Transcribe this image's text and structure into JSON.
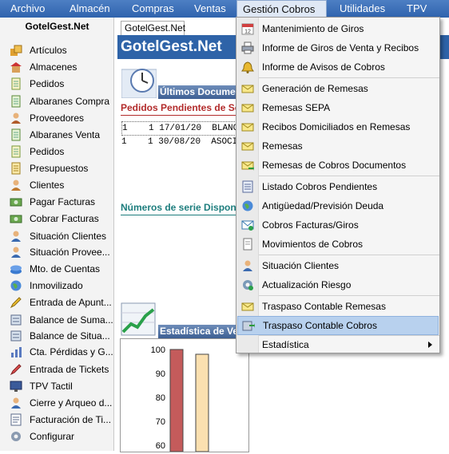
{
  "menubar": {
    "items": [
      "Archivo",
      "Almacén",
      "Compras",
      "Ventas",
      "Gestión Cobros",
      "Utilidades",
      "TPV"
    ]
  },
  "sidebar": {
    "title": "GotelGest.Net",
    "items": [
      {
        "label": "Artículos",
        "icon": "boxes-icon"
      },
      {
        "label": "Almacenes",
        "icon": "warehouse-icon"
      },
      {
        "label": "Pedidos",
        "icon": "document-icon"
      },
      {
        "label": "Albaranes Compra",
        "icon": "document-icon"
      },
      {
        "label": "Proveedores",
        "icon": "person-icon"
      },
      {
        "label": "Albaranes Venta",
        "icon": "document-icon"
      },
      {
        "label": "Pedidos",
        "icon": "document-icon"
      },
      {
        "label": "Presupuestos",
        "icon": "document-icon"
      },
      {
        "label": "Clientes",
        "icon": "person-icon"
      },
      {
        "label": "Pagar Facturas",
        "icon": "cash-icon"
      },
      {
        "label": "Cobrar Facturas",
        "icon": "cash-icon"
      },
      {
        "label": "Situación Clientes",
        "icon": "person-icon"
      },
      {
        "label": "Situación Provee...",
        "icon": "person-icon"
      },
      {
        "label": "Mto. de Cuentas",
        "icon": "bank-icon"
      },
      {
        "label": "Inmovilizado",
        "icon": "globe-icon"
      },
      {
        "label": "Entrada de Apunt...",
        "icon": "pencil-icon"
      },
      {
        "label": "Balance de Suma...",
        "icon": "balance-icon"
      },
      {
        "label": "Balance de Situa...",
        "icon": "balance-icon"
      },
      {
        "label": "Cta. Pérdidas y G...",
        "icon": "chart-icon"
      },
      {
        "label": "Entrada de Tickets",
        "icon": "ticket-icon"
      },
      {
        "label": "TPV Tactil",
        "icon": "monitor-icon"
      },
      {
        "label": "Cierre y Arqueo d...",
        "icon": "person-icon"
      },
      {
        "label": "Facturación de Ti...",
        "icon": "invoice-icon"
      },
      {
        "label": "Configurar",
        "icon": "gear-icon"
      }
    ]
  },
  "document": {
    "tab": "GotelGest.Net",
    "banner": "GotelGest.Net",
    "latest_section": "Últimos Documentos",
    "pending_orders_title": "Pedidos Pendientes de Servir",
    "rows": [
      {
        "c1": "1",
        "c2": "1",
        "date": "17/01/20",
        "name": "BLANCA GA"
      },
      {
        "c1": "1",
        "c2": "1",
        "date": "30/08/20",
        "name": "ASOCIACIO"
      }
    ],
    "serial_title": "Números de serie Disponibles",
    "stats_section": "Estadística de Ventas"
  },
  "chart_data": {
    "type": "bar",
    "categories": [
      "",
      ""
    ],
    "values": [
      100,
      98
    ],
    "series_colors": [
      "#c45b5b",
      "#fbe0b0"
    ],
    "yticks": [
      100,
      90,
      80,
      70,
      60
    ],
    "ylim": [
      55,
      100
    ],
    "title": "",
    "xlabel": "",
    "ylabel": ""
  },
  "dropdown": {
    "items": [
      {
        "label": "Mantenimiento de Giros",
        "icon": "calendar-icon",
        "sep_before": false
      },
      {
        "label": "Informe de Giros de Venta y Recibos",
        "icon": "printer-icon",
        "sep_before": false
      },
      {
        "label": "Informe de Avisos de Cobros",
        "icon": "bell-icon",
        "sep_before": false
      },
      {
        "label": "Generación de Remesas",
        "icon": "envelope-icon",
        "sep_before": true
      },
      {
        "label": "Remesas SEPA",
        "icon": "envelope-icon",
        "sep_before": false
      },
      {
        "label": "Recibos Domiciliados en Remesas",
        "icon": "envelope-icon",
        "sep_before": false
      },
      {
        "label": "Remesas",
        "icon": "envelope-icon",
        "sep_before": false
      },
      {
        "label": "Remesas de Cobros Documentos",
        "icon": "envelope-arrow-icon",
        "sep_before": false
      },
      {
        "label": "Listado Cobros Pendientes",
        "icon": "list-icon",
        "sep_before": true
      },
      {
        "label": "Antigüedad/Previsión Deuda",
        "icon": "globe-icon",
        "sep_before": false
      },
      {
        "label": "Cobros Facturas/Giros",
        "icon": "mail-icon",
        "sep_before": false
      },
      {
        "label": "Movimientos de Cobros",
        "icon": "page-icon",
        "sep_before": false
      },
      {
        "label": "Situación Clientes",
        "icon": "person-icon",
        "sep_before": true
      },
      {
        "label": "Actualización Riesgo",
        "icon": "gear-icon",
        "sep_before": false
      },
      {
        "label": "Traspaso Contable Remesas",
        "icon": "envelope-icon",
        "sep_before": true
      },
      {
        "label": "Traspaso Contable Cobros",
        "icon": "transfer-icon",
        "sep_before": false,
        "highlighted": true
      },
      {
        "label": "Estadística",
        "icon": "",
        "sep_before": true,
        "submenu": true
      }
    ]
  }
}
